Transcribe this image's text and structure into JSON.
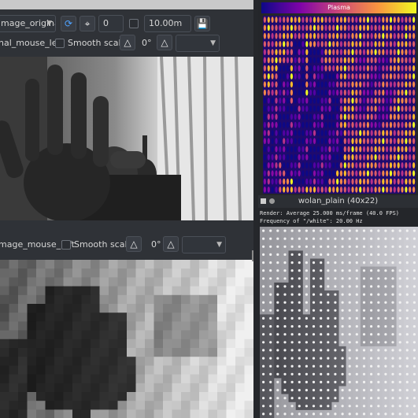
{
  "top_toolbar": {
    "source_combo": "mage_original",
    "rotation_value": "0",
    "distance_value": "10.00m"
  },
  "toolbar_original": {
    "mouse_combo": "nal_mouse_left",
    "smooth_label": "Smooth scaling"
  },
  "toolbar_lowres": {
    "mouse_combo": "mage_mouse_left",
    "smooth_label": "Smooth scaling",
    "rotation_value": "0°"
  },
  "right_panel": {
    "palette_title": "Plasma",
    "window_title": "wolan_plain (40x22)",
    "stats_line1": "Render: Average 25.000 ms/frame (40.0 FPS)",
    "stats_line2": "Frequency of \"/white\": 20.00 Hz"
  },
  "icons": [
    "refresh-icon",
    "crop-icon",
    "save-icon",
    "mouse-icon",
    "dropdown-arrow-icon"
  ]
}
